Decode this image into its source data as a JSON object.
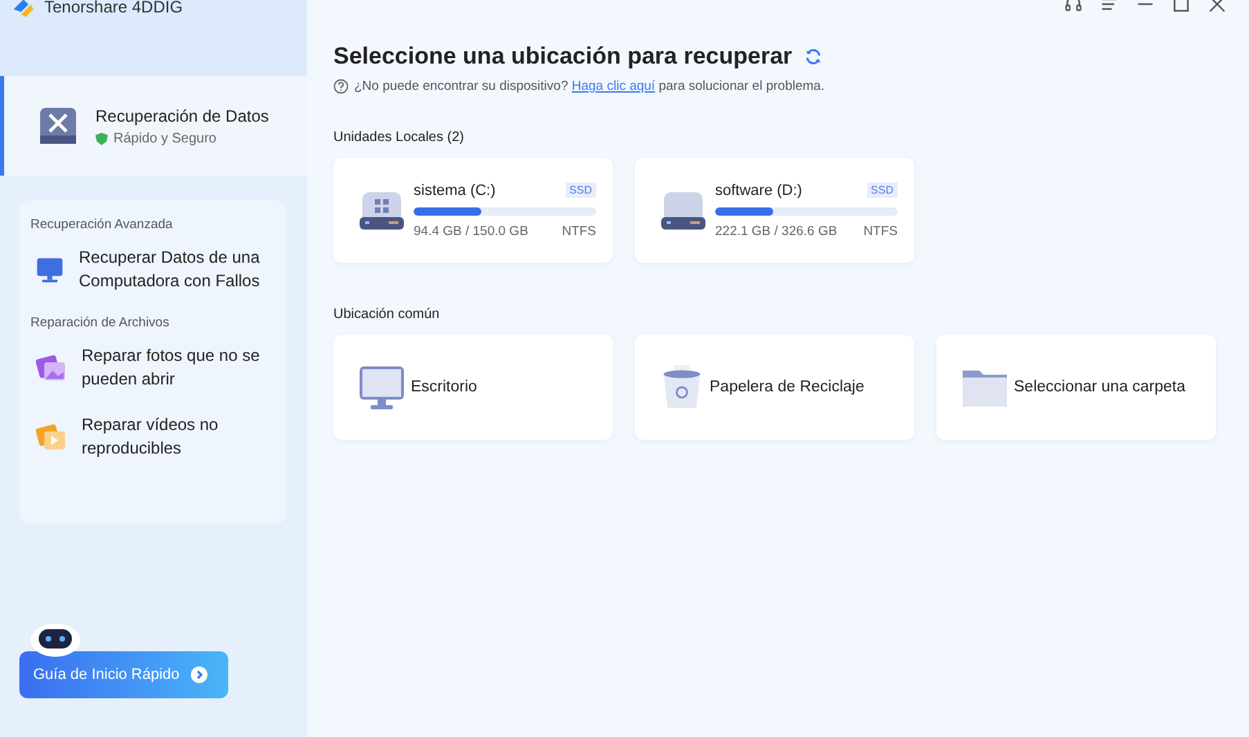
{
  "app": {
    "title": "Tenorshare 4DDIG"
  },
  "sidebar": {
    "main_item": {
      "title": "Recuperación de Datos",
      "subtitle": "Rápido y Seguro",
      "selected": true
    },
    "sections": [
      {
        "heading": "Recuperación Avanzada",
        "items": [
          {
            "label": "Recuperar Datos de una Computadora con Fallos",
            "kind": "computer"
          }
        ]
      },
      {
        "heading": "Reparación de Archivos",
        "items": [
          {
            "label": "Reparar fotos que no se pueden abrir",
            "kind": "photo"
          },
          {
            "label": "Reparar vídeos no reproducibles",
            "kind": "video"
          }
        ]
      }
    ],
    "guide_button": "Guía de Inicio Rápido"
  },
  "main": {
    "title": "Seleccione una ubicación para recuperar",
    "help": {
      "before": "¿No puede encontrar su dispositivo?",
      "link": "Haga clic aquí",
      "after": "para solucionar el problema."
    },
    "local_drives": {
      "heading": "Unidades Locales (2)",
      "drives": [
        {
          "name": "sistema (C:)",
          "type": "SSD",
          "level": 0.37,
          "usage": "94.4 GB / 150.0 GB",
          "fs": "NTFS",
          "kind": "system"
        },
        {
          "name": "software (D:)",
          "type": "SSD",
          "level": 0.32,
          "usage": "222.1 GB / 326.6 GB",
          "fs": "NTFS",
          "kind": "data"
        }
      ]
    },
    "common": {
      "heading": "Ubicación común",
      "places": [
        {
          "label": "Escritorio",
          "kind": "desktop"
        },
        {
          "label": "Papelera de Reciclaje",
          "kind": "trash"
        },
        {
          "label": "Seleccionar una carpeta",
          "kind": "folder"
        }
      ]
    }
  }
}
